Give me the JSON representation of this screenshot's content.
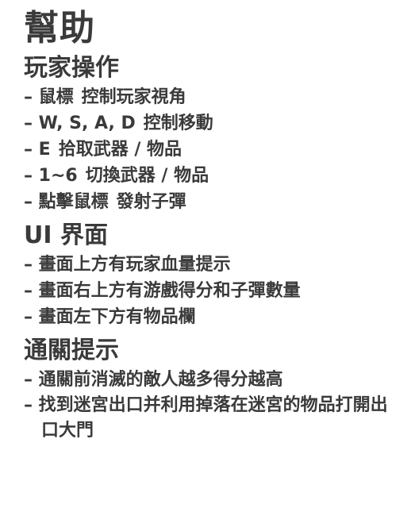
{
  "title": "幫助",
  "sections": [
    {
      "heading": "玩家操作",
      "items": [
        {
          "key": "– 鼠標",
          "desc": "控制玩家視角"
        },
        {
          "key": "– W, S, A, D",
          "desc": "控制移動"
        },
        {
          "key": "– E",
          "desc": "拾取武器 / 物品"
        },
        {
          "key": "– 1~6",
          "desc": "切換武器 / 物品"
        },
        {
          "key": "– 點擊鼠標",
          "desc": "發射子彈"
        }
      ]
    },
    {
      "heading": "UI 界面",
      "items": [
        {
          "text": "– 畫面上方有玩家血量提示"
        },
        {
          "text": "– 畫面右上方有游戲得分和子彈數量"
        },
        {
          "text": "– 畫面左下方有物品欄"
        }
      ]
    },
    {
      "heading": "通關提示",
      "items": [
        {
          "text": "– 通關前消滅的敵人越多得分越高"
        },
        {
          "text": "– 找到迷宮出口并利用掉落在迷宮的物品打開出口大門"
        }
      ]
    }
  ]
}
